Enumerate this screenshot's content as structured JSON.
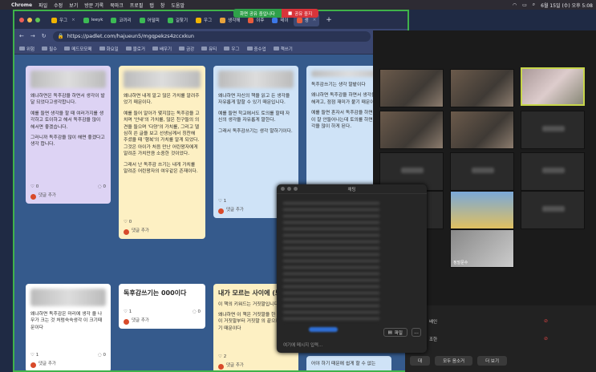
{
  "menubar": {
    "app": "Chrome",
    "items": [
      "파일",
      "수정",
      "보기",
      "방문 기록",
      "북마크",
      "프로필",
      "탭",
      "창",
      "도움말"
    ],
    "clock": "6월 15일 (수) 오후 5:08"
  },
  "share": {
    "status": "화면 공유 중입니다",
    "stop": "공유 중지"
  },
  "tabs": [
    {
      "label": "우그",
      "color": "#f0b400"
    },
    {
      "label": "leeyk",
      "color": "#3cba54"
    },
    {
      "label": "코끼리",
      "color": "#3cba54"
    },
    {
      "label": "어덜피",
      "color": "#3cba54"
    },
    {
      "label": "길찾기",
      "color": "#3cba54"
    },
    {
      "label": "우그",
      "color": "#f0b400"
    },
    {
      "label": "생각해",
      "color": "#e8a33c"
    },
    {
      "label": "이후",
      "color": "#e85c3c"
    },
    {
      "label": "테이",
      "color": "#3c78e8"
    },
    {
      "label": "생",
      "color": "#e85c3c"
    }
  ],
  "url": "https://padlet.com/hajueun5/mgqpekzs4zccxkun",
  "bookmarks": [
    "위험",
    "필수",
    "메드모모페",
    "화요일",
    "블로거",
    "배우기",
    "금강",
    "뮤티",
    "우그",
    "중수업",
    "책쓰기"
  ],
  "cards": {
    "c1": {
      "body": [
        "왜냐하면은 독후감을 하면서 생각이 발달 되었다고생각합니다.",
        "예를 들면 생각을 할 때 여러가지를 생각하고 토이하고 해서 독후감을 많이 해서면 좋겠습니다.",
        "그러니까 독후감을 많이 해면 좋겠다고생각 합니다."
      ],
      "likes": "0",
      "comments": "0",
      "add": "댓글 추가"
    },
    "c2": {
      "body": [
        "왜냐하면 내게 알고 많은 가치를 알려주었기 때문이다.",
        "예를 들어 알아가 몇지않는 독후감을 고치며 '안내'의 가치를, 많은 친구들의 의견을 들으며 '다양'의 가치를, 그리고 델심히 쓴 글을 보고 선생님께서 칭찬해 주셨을 때 '행복'의 가치를 알게 되었다. 그것은 아이가 처음 만난 어린왕자에게 알려준 가치만큼 소중한 것이었다.",
        "그래서 난 독후감 쓰기는 내게 가치를 알려준 어린왕자의 여우같은 존재이다."
      ],
      "likes": "0",
      "add": "댓글 추가"
    },
    "c3": {
      "body": [
        "왜냐하면 자신의 책을 읽고 든 생각을 자유롭게 말할 수 있기 때문입니다.",
        "예를 들면 학교에서도 토의를 할때 자신의 생각을 자유롭게 말한다.",
        "그래서 독후감쓰기는 생각 말하기이다."
      ],
      "likes": "1",
      "add": "댓글 추가"
    },
    "c4": {
      "body": [
        "독후감쓰기는 생각 말밭이다",
        "왜냐하면 독후감을 하면서 생각을 풍부해져고, 점점 재미가 붙기 때문이다.",
        "예를 들면 혼자서 독후감을 하면 생각이 잘 안들어나는데 토의를 하면은 생각을 많이 하게 된다."
      ]
    },
    "c5": {
      "body": [
        "왜냐하면 독후감은 마리에 생각 을 나무가 크는 것 처럼숙숙생각 이 크기때문이다"
      ],
      "likes": "1",
      "comments": "0",
      "add": "댓글 추가"
    },
    "c6": {
      "title": "독후감쓰기는 000이다",
      "likes": "1",
      "comments": "0",
      "add": "댓글 추가"
    },
    "c7": {
      "title": "내가 모르는 사이에 (보 윤)",
      "body": [
        "이 책의 키워드는 거짓말입니다.",
        "왜냐하면 이 책은 거짓말을 한 편 사건이 거짓말부터 거짓말 의 끝으로 끝나기 때문이다"
      ],
      "likes": "2",
      "add": "댓글 추가"
    },
    "c8": {
      "body": [
        "어야 하기 때문에 쉽게 할 수 없는"
      ]
    }
  },
  "chat": {
    "title": "채팅",
    "placeholder": "여기에 메시지 입력...",
    "file": "파일",
    "more": "..."
  },
  "zoom": {
    "self_label": "정말문수",
    "participants_bar": {
      "leave": "대",
      "invite": "모두 음소거",
      "more": "더 보기"
    },
    "rows": [
      "배인",
      "조한"
    ]
  }
}
